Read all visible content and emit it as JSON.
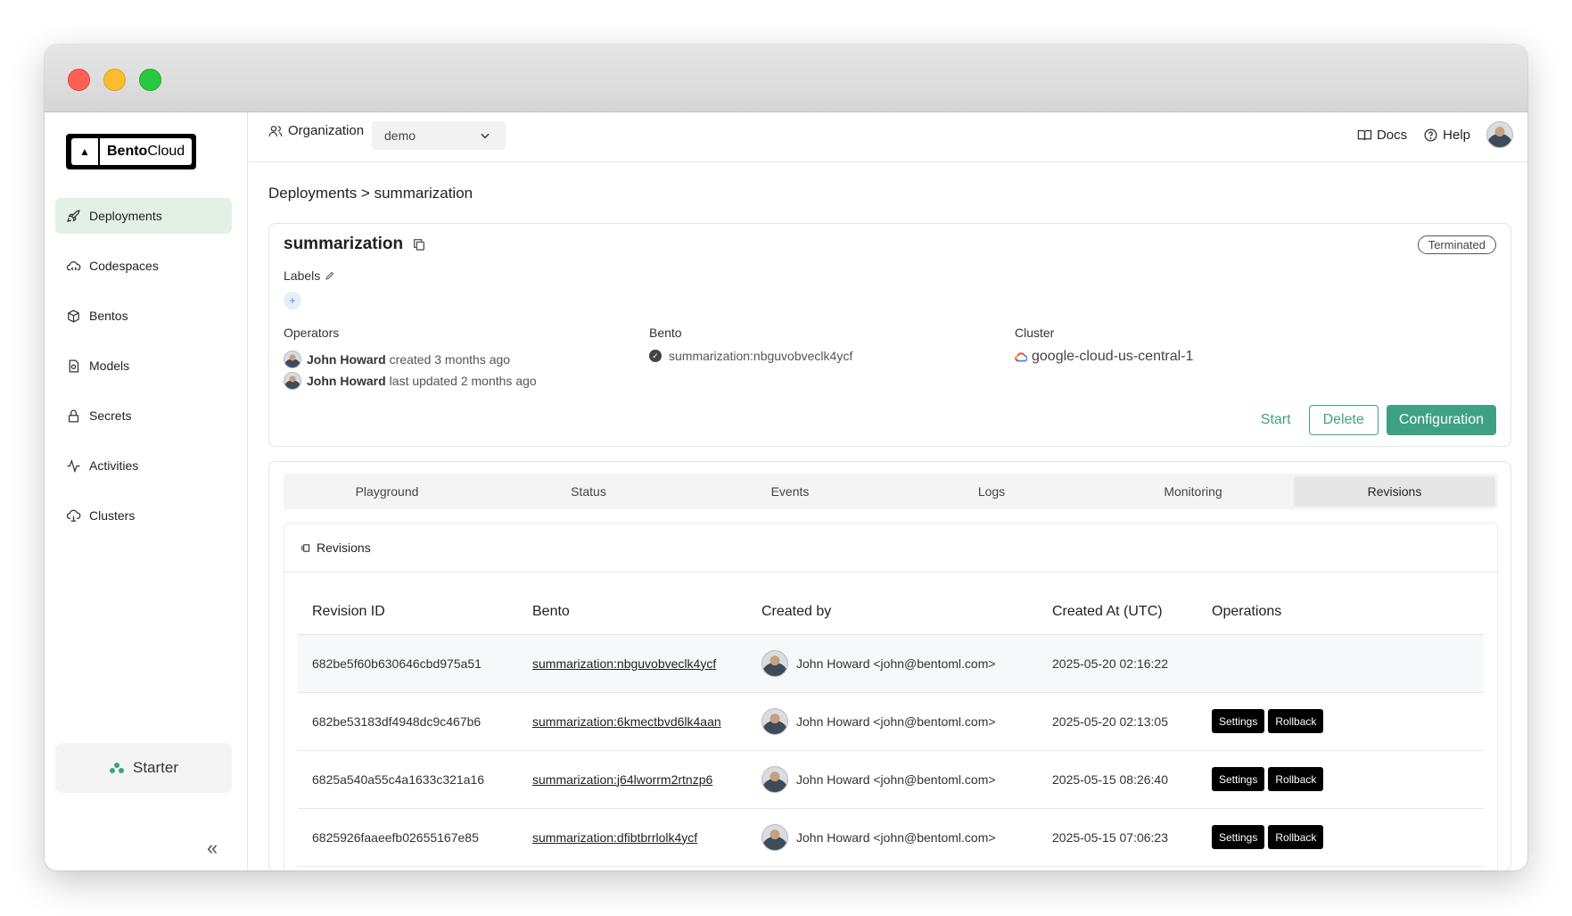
{
  "sidebar": {
    "logo": {
      "bold": "Bento",
      "rest": "Cloud"
    },
    "items": [
      {
        "label": "Deployments",
        "icon": "rocket-icon"
      },
      {
        "label": "Codespaces",
        "icon": "cloud-code-icon"
      },
      {
        "label": "Bentos",
        "icon": "box-icon"
      },
      {
        "label": "Models",
        "icon": "model-file-icon"
      },
      {
        "label": "Secrets",
        "icon": "lock-icon"
      },
      {
        "label": "Activities",
        "icon": "activity-icon"
      },
      {
        "label": "Clusters",
        "icon": "cloud-server-icon"
      }
    ],
    "plan": "Starter",
    "collapse": "«"
  },
  "topbar": {
    "org_label": "Organization",
    "org_value": "demo",
    "docs": "Docs",
    "help": "Help"
  },
  "breadcrumb": "Deployments > summarization",
  "deployment": {
    "name": "summarization",
    "status": "Terminated",
    "labels_title": "Labels",
    "add_label": "+",
    "operators_title": "Operators",
    "operators": [
      {
        "name": "John Howard",
        "action": "created 3 months ago"
      },
      {
        "name": "John Howard",
        "action": "last updated 2 months ago"
      }
    ],
    "bento_title": "Bento",
    "bento": "summarization:nbguvobveclk4ycf",
    "cluster_title": "Cluster",
    "cluster": "google-cloud-us-central-1",
    "actions": {
      "start": "Start",
      "delete": "Delete",
      "configuration": "Configuration"
    }
  },
  "tabs": [
    "Playground",
    "Status",
    "Events",
    "Logs",
    "Monitoring",
    "Revisions"
  ],
  "active_tab": "Revisions",
  "revisions": {
    "title": "Revisions",
    "columns": [
      "Revision ID",
      "Bento",
      "Created by",
      "Created At (UTC)",
      "Operations"
    ],
    "rows": [
      {
        "id": "682be5f60b630646cbd975a51",
        "bento": "summarization:nbguvobveclk4ycf",
        "created_by": "John Howard <john@bentoml.com>",
        "created_at": "2025-05-20 02:16:22",
        "ops": false
      },
      {
        "id": "682be53183df4948dc9c467b6",
        "bento": "summarization:6kmectbvd6lk4aan",
        "created_by": "John Howard <john@bentoml.com>",
        "created_at": "2025-05-20 02:13:05",
        "ops": true
      },
      {
        "id": "6825a540a55c4a1633c321a16",
        "bento": "summarization:j64lworrm2rtnzp6",
        "created_by": "John Howard <john@bentoml.com>",
        "created_at": "2025-05-15 08:26:40",
        "ops": true
      },
      {
        "id": "6825926faaeefb02655167e85",
        "bento": "summarization:dfibtbrrlolk4ycf",
        "created_by": "John Howard <john@bentoml.com>",
        "created_at": "2025-05-15 07:06:23",
        "ops": true
      }
    ],
    "settings_label": "Settings",
    "rollback_label": "Rollback"
  },
  "colors": {
    "accent": "#3fa184",
    "active_nav": "#e3f0e6"
  }
}
